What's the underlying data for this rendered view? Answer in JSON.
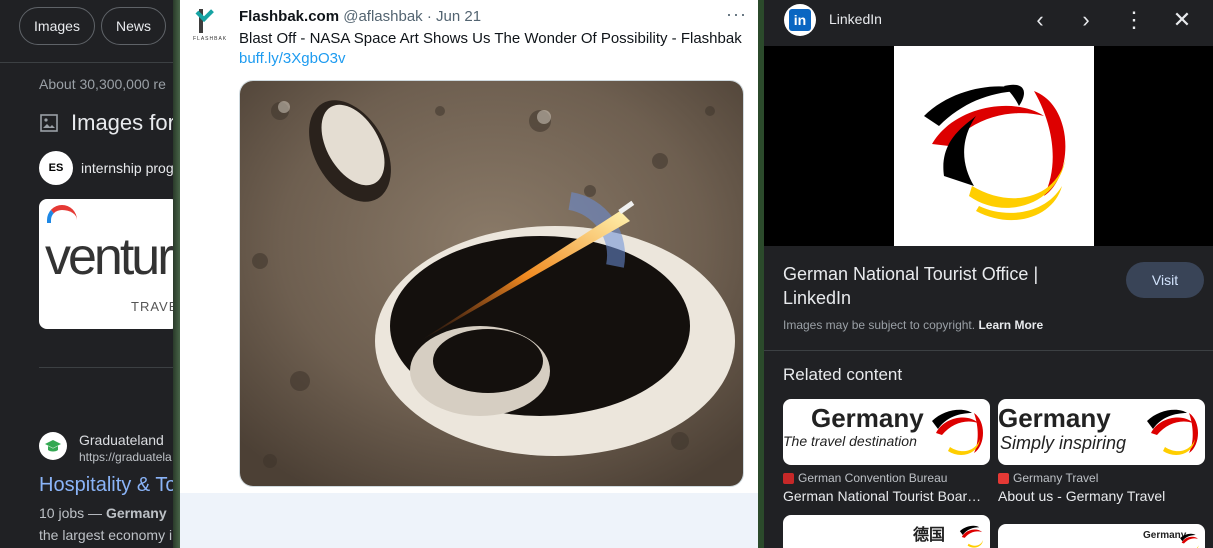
{
  "google": {
    "chips": [
      "Images",
      "News"
    ],
    "results_count": "About 30,300,000 re",
    "images_for": "Images for",
    "internship_text": "internship prog",
    "internship_thumb": "ES",
    "ventura_text": "ventura",
    "ventura_sub": "TRAVEL",
    "result": {
      "site": "Graduateland",
      "url": "https://graduatela",
      "title": "Hospitality & To",
      "snippet_prefix": "10 jobs — ",
      "snippet_bold": "Germany",
      "snippet_line2": "the largest economy i"
    }
  },
  "tweet": {
    "avatar_text": "FLASHBAK",
    "name": "Flashbak.com",
    "handle": "@aflashbak",
    "separator": "·",
    "date": "Jun 21",
    "more": "···",
    "text": "Blast Off - NASA Space Art Shows Us The Wonder Of Possibility - Flashbak",
    "link": "buff.ly/3XgbO3v"
  },
  "viewer": {
    "source_icon": "in",
    "source_name": "LinkedIn",
    "nav": {
      "prev": "‹",
      "next": "›",
      "more": "⋮",
      "close": "✕"
    },
    "title": "German National Tourist Office | LinkedIn",
    "visit_label": "Visit",
    "copyright_text": "Images may be subject to copyright. ",
    "learn_more": "Learn More",
    "related_title": "Related content",
    "related": [
      {
        "img_title": "Germany",
        "img_sub": "The travel destination",
        "source": "German Convention Bureau",
        "title": "German National Tourist Boar…"
      },
      {
        "img_title": "Germany",
        "img_sub": "Simply inspiring",
        "source": "Germany Travel",
        "title": "About us - Germany Travel"
      },
      {
        "img_title": "德国",
        "img_sub": "",
        "source": "",
        "title": ""
      },
      {
        "img_title": "Germany",
        "img_sub": "",
        "source": "",
        "title": ""
      }
    ]
  },
  "colors": {
    "accent_link": "#8ab4f8",
    "twitter_link": "#1d9bf0",
    "linkedin_blue": "#0a66c2",
    "german_black": "#000000",
    "german_red": "#dd0000",
    "german_gold": "#ffce00"
  }
}
